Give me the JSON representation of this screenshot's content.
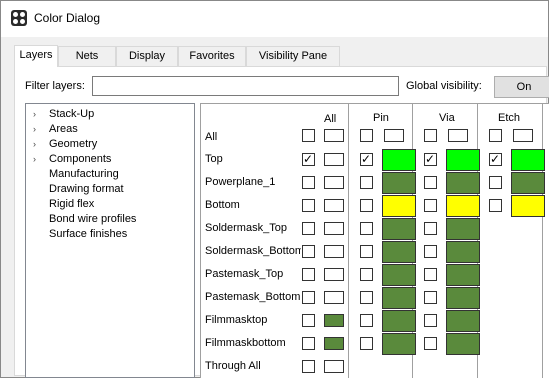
{
  "window": {
    "title": "Color Dialog"
  },
  "tabs": [
    "Layers",
    "Nets",
    "Display",
    "Favorites",
    "Visibility Pane"
  ],
  "filter": {
    "label": "Filter layers:",
    "value": ""
  },
  "global_visibility": {
    "label": "Global visibility:",
    "button": "On"
  },
  "tree": [
    "Stack-Up",
    "Areas",
    "Geometry",
    "Components",
    "Manufacturing",
    "Drawing format",
    "Rigid flex",
    "Bond wire profiles",
    "Surface finishes"
  ],
  "columns": {
    "all": "All",
    "pin": "Pin",
    "via": "Via",
    "etch": "Etch"
  },
  "rows": [
    {
      "label": "All"
    },
    {
      "label": "Top"
    },
    {
      "label": "Powerplane_1"
    },
    {
      "label": "Bottom"
    },
    {
      "label": "Soldermask_Top"
    },
    {
      "label": "Soldermask_Bottom"
    },
    {
      "label": "Pastemask_Top"
    },
    {
      "label": "Pastemask_Bottom"
    },
    {
      "label": "Filmmasktop"
    },
    {
      "label": "Filmmaskbottom"
    },
    {
      "label": "Through All"
    }
  ],
  "colors": {
    "green": "#00ff00",
    "olive": "#5a8a3c",
    "yellow": "#ffff00",
    "white": "#ffffff"
  }
}
